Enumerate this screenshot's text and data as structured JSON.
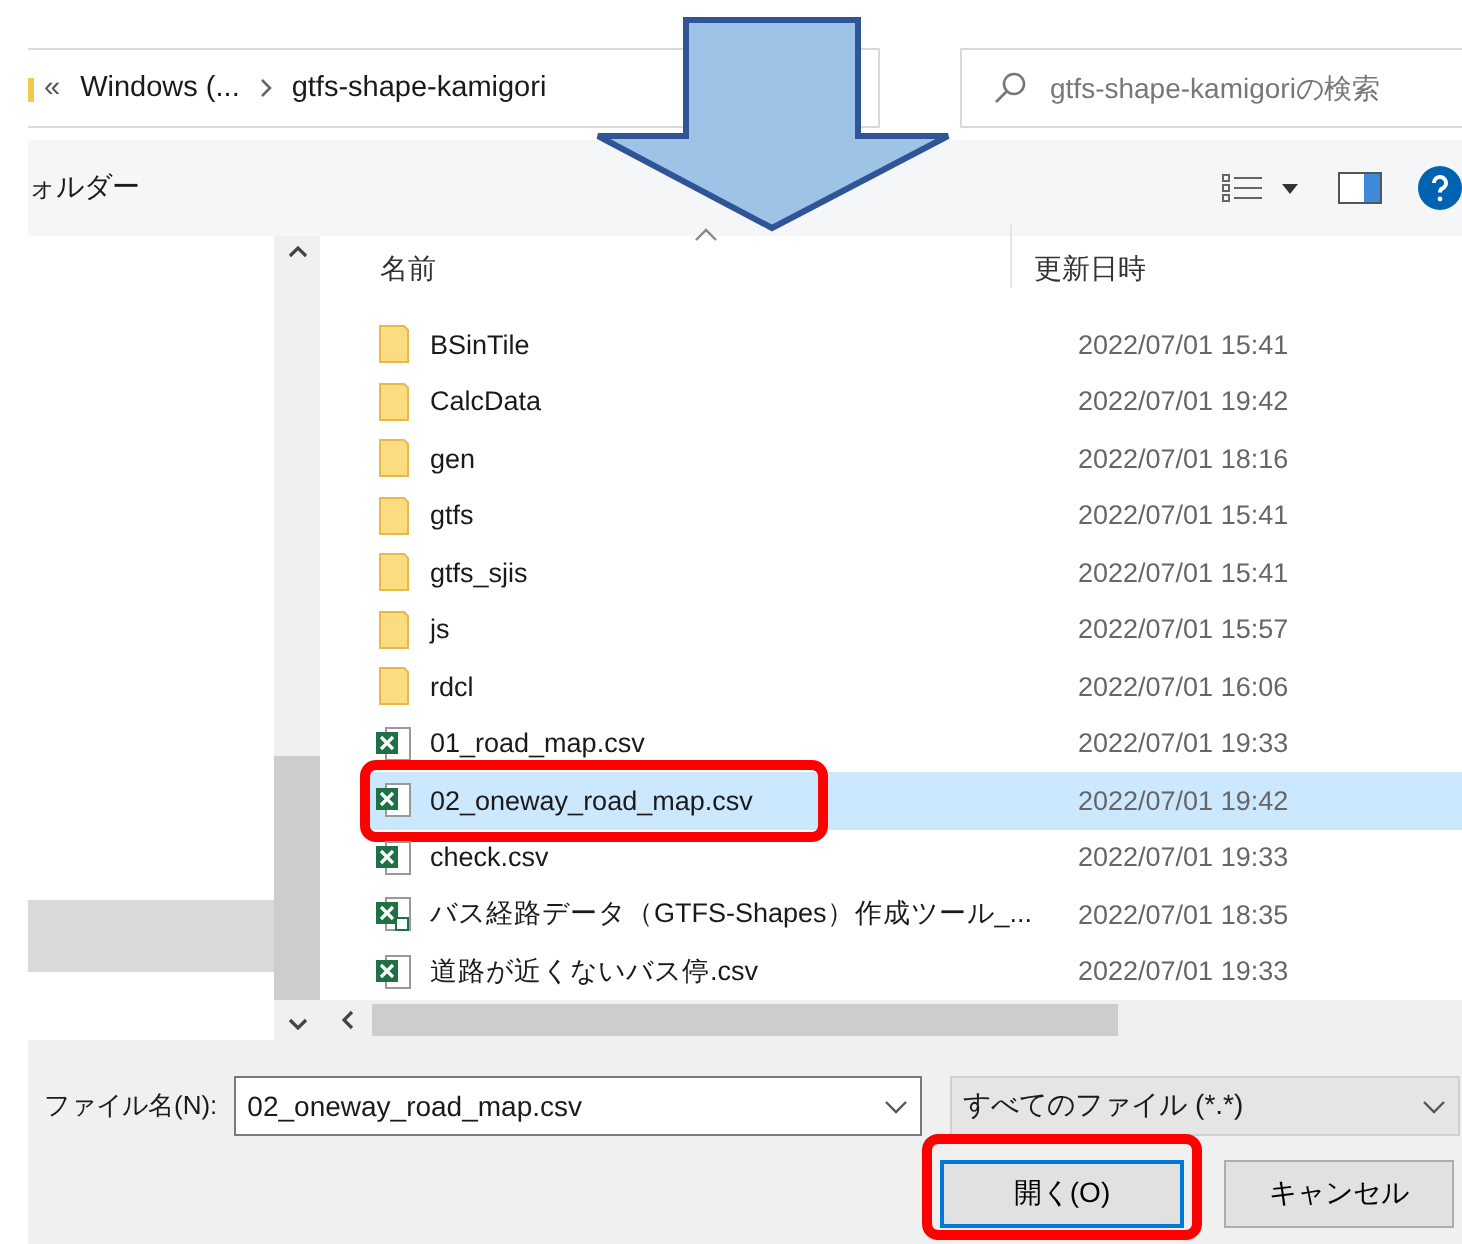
{
  "address_bar": {
    "overflow": "«",
    "crumbs": [
      "Windows (...",
      "gtfs-shape-kamigori"
    ]
  },
  "search": {
    "placeholder": "gtfs-shape-kamigoriの検索"
  },
  "toolbar": {
    "new_folder": "ォルダー"
  },
  "columns": [
    {
      "label": "名前",
      "sorted": true
    },
    {
      "label": "更新日時",
      "sorted": false
    }
  ],
  "files": [
    {
      "name": "BSinTile",
      "modified": "2022/07/01 15:41",
      "kind": "folder",
      "selected": false,
      "highlighted": false
    },
    {
      "name": "CalcData",
      "modified": "2022/07/01 19:42",
      "kind": "folder",
      "selected": false,
      "highlighted": false
    },
    {
      "name": "gen",
      "modified": "2022/07/01 18:16",
      "kind": "folder",
      "selected": false,
      "highlighted": false
    },
    {
      "name": "gtfs",
      "modified": "2022/07/01 15:41",
      "kind": "folder",
      "selected": false,
      "highlighted": false
    },
    {
      "name": "gtfs_sjis",
      "modified": "2022/07/01 15:41",
      "kind": "folder",
      "selected": false,
      "highlighted": false
    },
    {
      "name": "js",
      "modified": "2022/07/01 15:57",
      "kind": "folder",
      "selected": false,
      "highlighted": false
    },
    {
      "name": "rdcl",
      "modified": "2022/07/01 16:06",
      "kind": "folder",
      "selected": false,
      "highlighted": false
    },
    {
      "name": "01_road_map.csv",
      "modified": "2022/07/01 19:33",
      "kind": "csv",
      "selected": false,
      "highlighted": false
    },
    {
      "name": "02_oneway_road_map.csv",
      "modified": "2022/07/01 19:42",
      "kind": "csv",
      "selected": true,
      "highlighted": true
    },
    {
      "name": "check.csv",
      "modified": "2022/07/01 19:33",
      "kind": "csv",
      "selected": false,
      "highlighted": false
    },
    {
      "name": "バス経路データ（GTFS-Shapes）作成ツール_...",
      "modified": "2022/07/01 18:35",
      "kind": "macro",
      "selected": false,
      "highlighted": false
    },
    {
      "name": "道路が近くないバス停.csv",
      "modified": "2022/07/01 19:33",
      "kind": "csv",
      "selected": false,
      "highlighted": false
    }
  ],
  "file_name": {
    "label": "ファイル名(N):",
    "value": "02_oneway_road_map.csv"
  },
  "file_type": {
    "value": "すべてのファイル (*.*)"
  },
  "buttons": [
    {
      "label": "開く(O)",
      "kind": "primary",
      "highlighted": true
    },
    {
      "label": "キャンセル",
      "kind": "normal",
      "highlighted": false
    }
  ]
}
